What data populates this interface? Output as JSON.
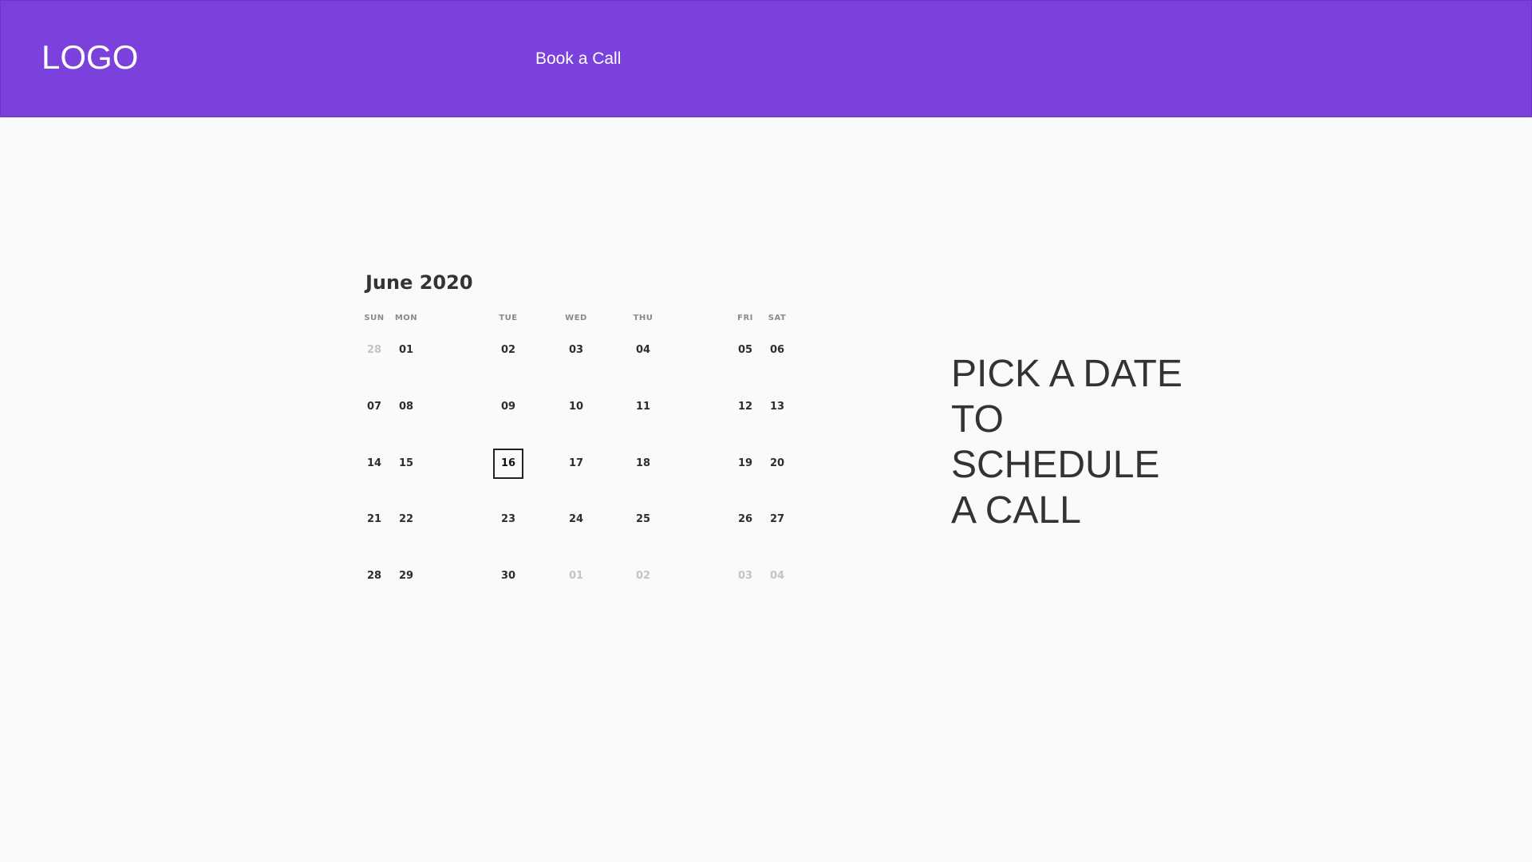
{
  "header": {
    "logo": "LOGO",
    "nav_link": "Book a Call",
    "background_color": "#7b41dd"
  },
  "calendar": {
    "month_label": "June 2020",
    "weekdays": [
      "SUN",
      "MON",
      "TUE",
      "WED",
      "THU",
      "FRI",
      "SAT"
    ],
    "selected_day": "16",
    "weeks": [
      [
        {
          "label": "28",
          "muted": true
        },
        {
          "label": "01"
        },
        {
          "label": "02"
        },
        {
          "label": "03"
        },
        {
          "label": "04"
        },
        {
          "label": "05"
        },
        {
          "label": "06"
        }
      ],
      [
        {
          "label": "07"
        },
        {
          "label": "08"
        },
        {
          "label": "09"
        },
        {
          "label": "10"
        },
        {
          "label": "11"
        },
        {
          "label": "12"
        },
        {
          "label": "13"
        }
      ],
      [
        {
          "label": "14"
        },
        {
          "label": "15"
        },
        {
          "label": "16",
          "selected": true
        },
        {
          "label": "17"
        },
        {
          "label": "18"
        },
        {
          "label": "19"
        },
        {
          "label": "20"
        }
      ],
      [
        {
          "label": "21"
        },
        {
          "label": "22"
        },
        {
          "label": "23"
        },
        {
          "label": "24"
        },
        {
          "label": "25"
        },
        {
          "label": "26"
        },
        {
          "label": "27"
        }
      ],
      [
        {
          "label": "28"
        },
        {
          "label": "29"
        },
        {
          "label": "30"
        },
        {
          "label": "01",
          "muted": true
        },
        {
          "label": "02",
          "muted": true
        },
        {
          "label": "03",
          "muted": true
        },
        {
          "label": "04",
          "muted": true
        }
      ]
    ]
  },
  "cta": {
    "lines": [
      "PICK A DATE",
      "TO",
      "SCHEDULE",
      "A CALL"
    ]
  }
}
